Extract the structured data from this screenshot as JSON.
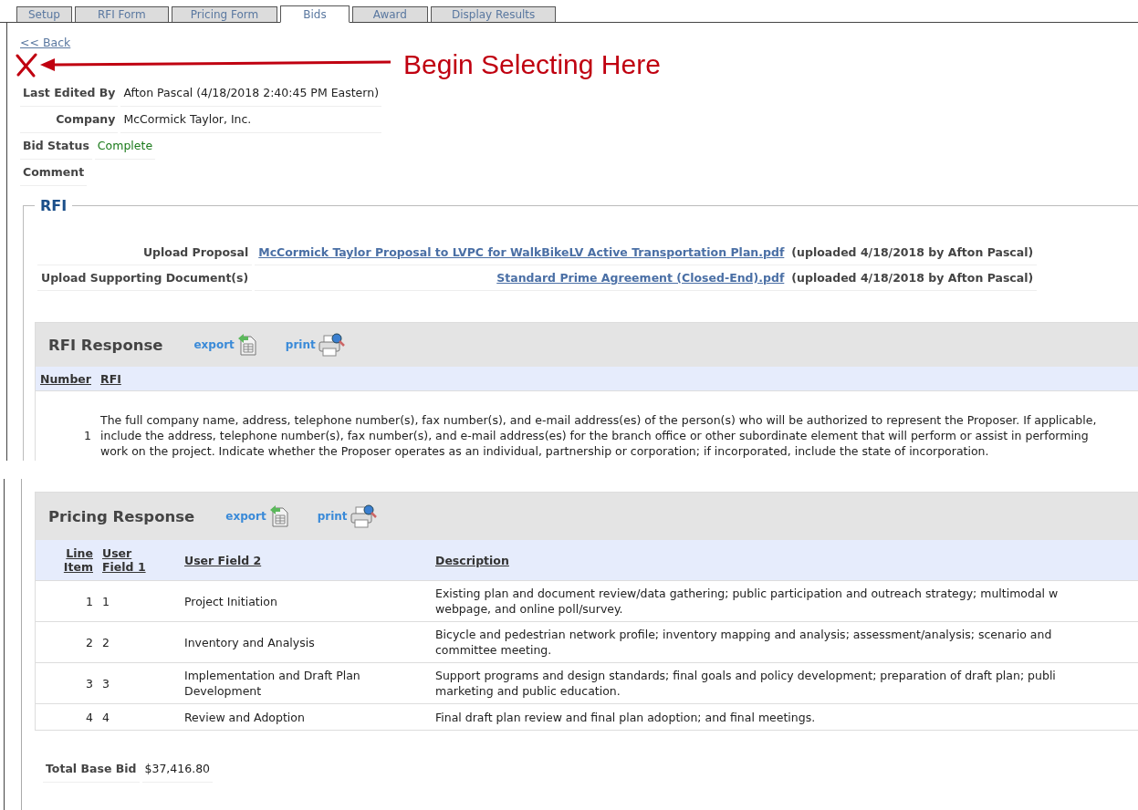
{
  "tabs": [
    {
      "label": "Setup",
      "selected": false
    },
    {
      "label": "RFI Form",
      "selected": false
    },
    {
      "label": "Pricing Form",
      "selected": false
    },
    {
      "label": "Bids",
      "selected": true
    },
    {
      "label": "Award",
      "selected": false
    },
    {
      "label": "Display Results",
      "selected": false
    }
  ],
  "back_link": "<< Back",
  "annotation": {
    "text": "Begin Selecting Here"
  },
  "field_groups": [
    [
      {
        "label": "Last Edited By",
        "value": "Afton Pascal (4/18/2018 2:40:45 PM Eastern)",
        "kind": "text"
      },
      {
        "label": "Company",
        "value": "McCormick Taylor, Inc.",
        "kind": "text"
      }
    ],
    [
      {
        "label": "Bid Status",
        "value": "Complete",
        "kind": "status"
      }
    ],
    [
      {
        "label": "Comment"
      }
    ]
  ],
  "rfi": {
    "legend": "RFI",
    "uploads": [
      {
        "label": "Upload Proposal",
        "file": "McCormick Taylor  Proposal to LVPC for WalkBikeLV Active Transportation Plan.pdf",
        "note": "(uploaded 4/18/2018 by Afton Pascal)"
      },
      {
        "label": "Upload Supporting Document(s)",
        "file": "Standard Prime Agreement (Closed-End).pdf",
        "note": "(uploaded 4/18/2018 by Afton Pascal)"
      }
    ],
    "response": {
      "title": "RFI Response",
      "export": "export",
      "print": "print",
      "columns": [
        "Number",
        "RFI"
      ],
      "rows": [
        {
          "number": "1",
          "text": "The full company name, address, telephone number(s), fax number(s), and e-mail address(es) of the person(s) who will be authorized to represent the Proposer. If applicable,\ninclude the address, telephone number(s), fax number(s), and e-mail address(es) for the branch office or other subordinate element that will perform or assist in performing\nwork on the project. Indicate whether the Proposer operates as an individual, partnership or corporation; if incorporated, include the state of incorporation."
        }
      ]
    }
  },
  "pricing": {
    "title": "Pricing Response",
    "export": "export",
    "print": "print",
    "columns": [
      "Line Item",
      "User Field 1",
      "User Field 2",
      "Description"
    ],
    "rows": [
      {
        "line_item": "1",
        "user_field_1": "1",
        "user_field_2": "Project Initiation",
        "description": "Existing plan and document review/data gathering; public participation and outreach strategy; multimodal w\nwebpage, and online poll/survey."
      },
      {
        "line_item": "2",
        "user_field_1": "2",
        "user_field_2": "Inventory and Analysis",
        "description": "Bicycle and pedestrian network profile; inventory mapping and analysis; assessment/analysis; scenario and\ncommittee meeting."
      },
      {
        "line_item": "3",
        "user_field_1": "3",
        "user_field_2": "Implementation and Draft Plan Development",
        "description": "Support programs and design standards; final goals and policy development; preparation of draft plan; publi\nmarketing and public education."
      },
      {
        "line_item": "4",
        "user_field_1": "4",
        "user_field_2": "Review and Adoption",
        "description": "Final draft plan review and final plan adoption; and final meetings."
      }
    ],
    "total": {
      "label": "Total Base Bid",
      "value": "$37,416.80"
    }
  }
}
